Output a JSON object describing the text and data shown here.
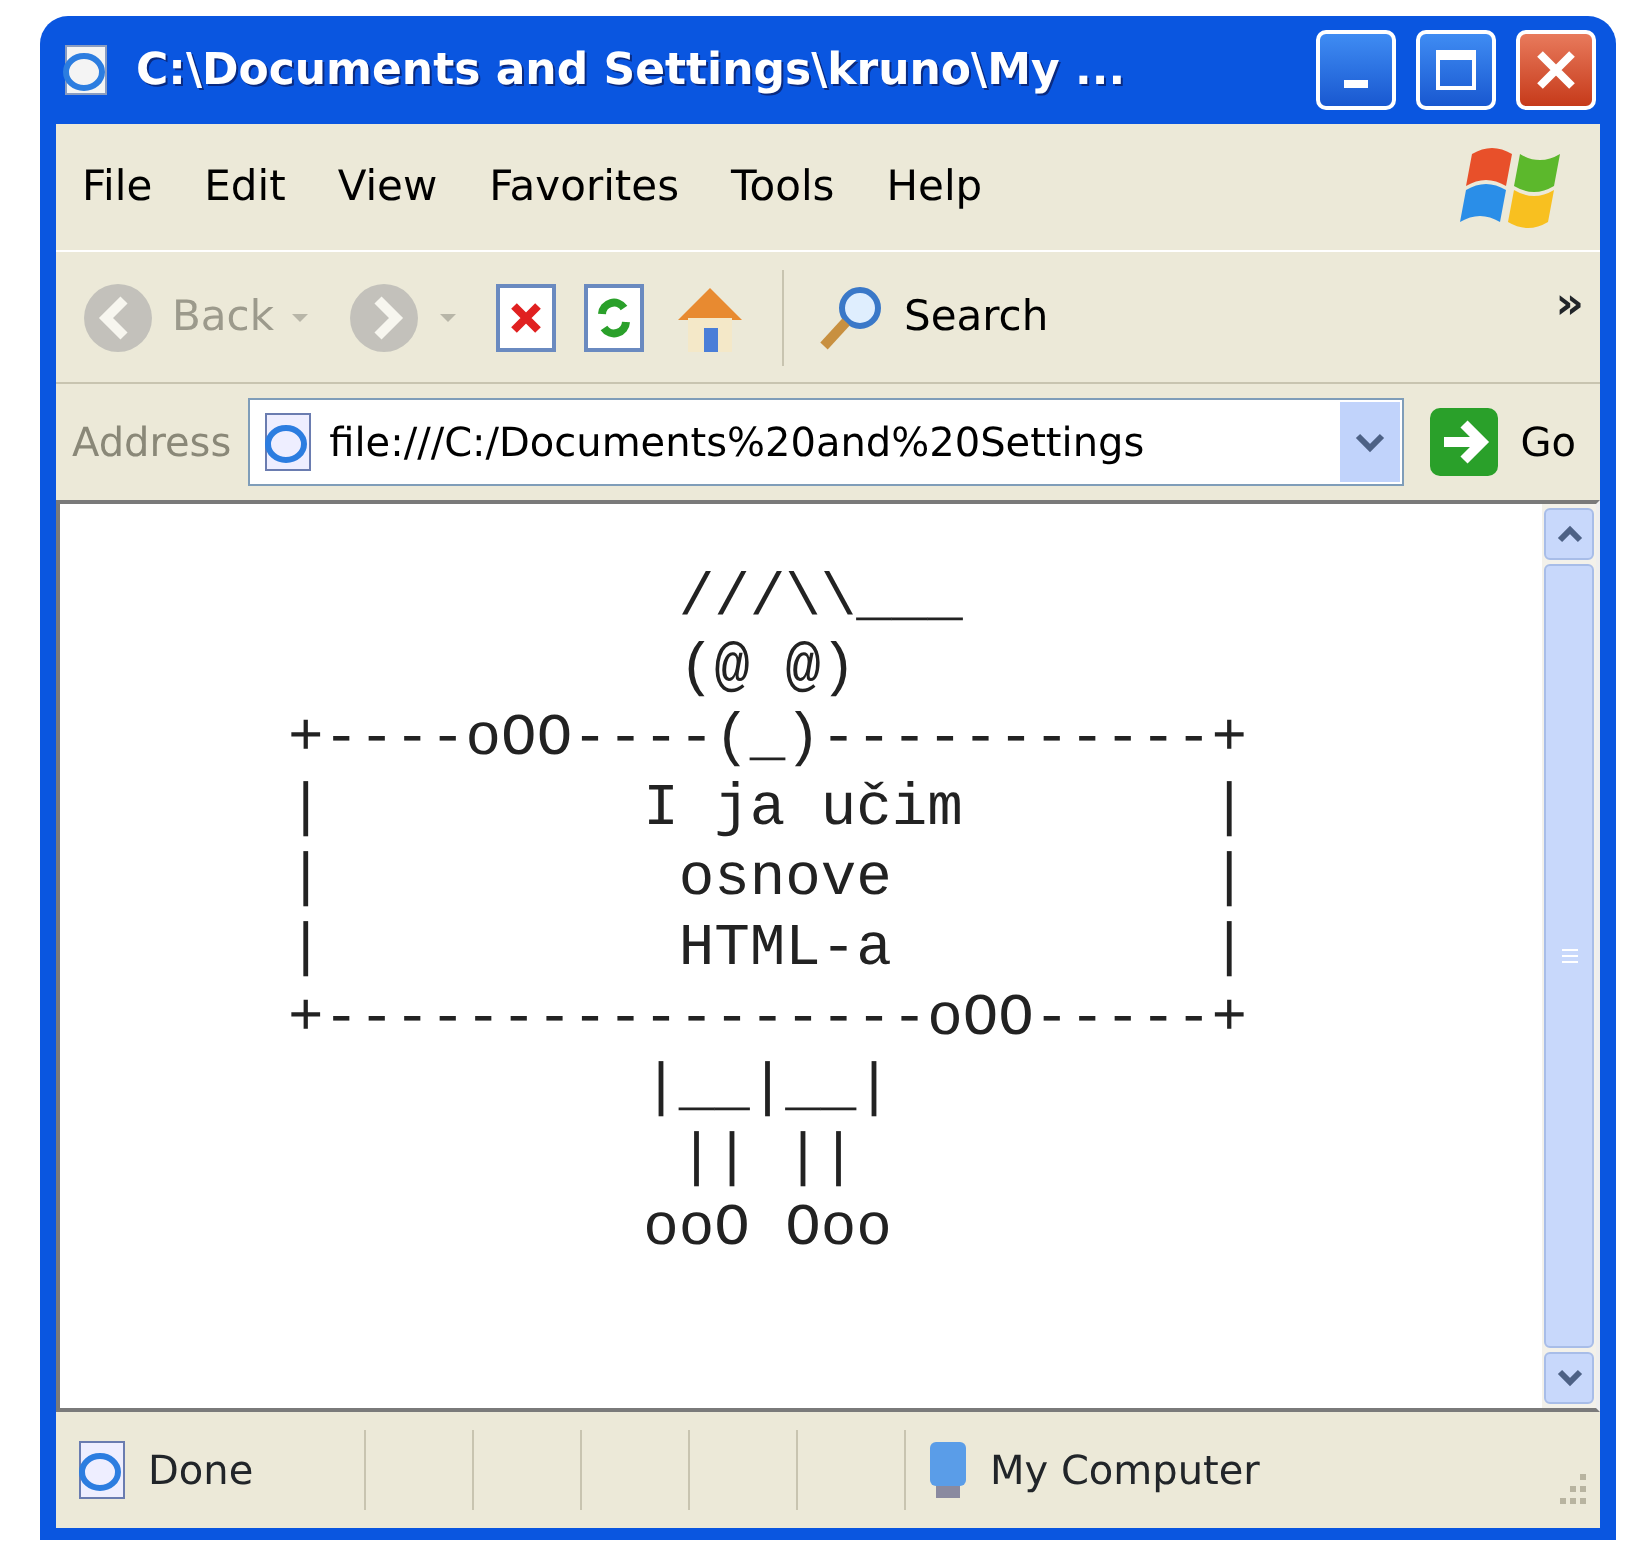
{
  "window": {
    "title": "C:\\Documents and Settings\\kruno\\My ..."
  },
  "menu": [
    {
      "label": "File"
    },
    {
      "label": "Edit"
    },
    {
      "label": "View"
    },
    {
      "label": "Favorites"
    },
    {
      "label": "Tools"
    },
    {
      "label": "Help"
    }
  ],
  "toolbar": [
    {
      "kind": "back",
      "label": "Back",
      "disabled": true
    },
    {
      "kind": "dropdown",
      "disabled": true
    },
    {
      "kind": "forward",
      "disabled": true
    },
    {
      "kind": "dropdown",
      "disabled": true
    },
    {
      "kind": "stop",
      "disabled": false
    },
    {
      "kind": "refresh",
      "disabled": false
    },
    {
      "kind": "home",
      "disabled": false
    },
    {
      "kind": "separator"
    },
    {
      "kind": "search",
      "label": "Search",
      "disabled": false
    }
  ],
  "toolbar_overflow": "»",
  "address_bar": {
    "label": "Address",
    "value": "file:///C:/Documents%20and%20Settings",
    "go": "Go"
  },
  "content": {
    "ascii_art": [
      "           ///\\\\___",
      "           (@ @)",
      "+----oOO----(_)-----------+",
      "|         I ja učim       |",
      "|          osnove         |",
      "|          HTML-a         |",
      "+-----------------oOO-----+",
      "          |__|__|",
      "           || ||",
      "          ooO Ooo"
    ]
  },
  "status_bar": {
    "status": "Done",
    "zone": "My Computer"
  }
}
